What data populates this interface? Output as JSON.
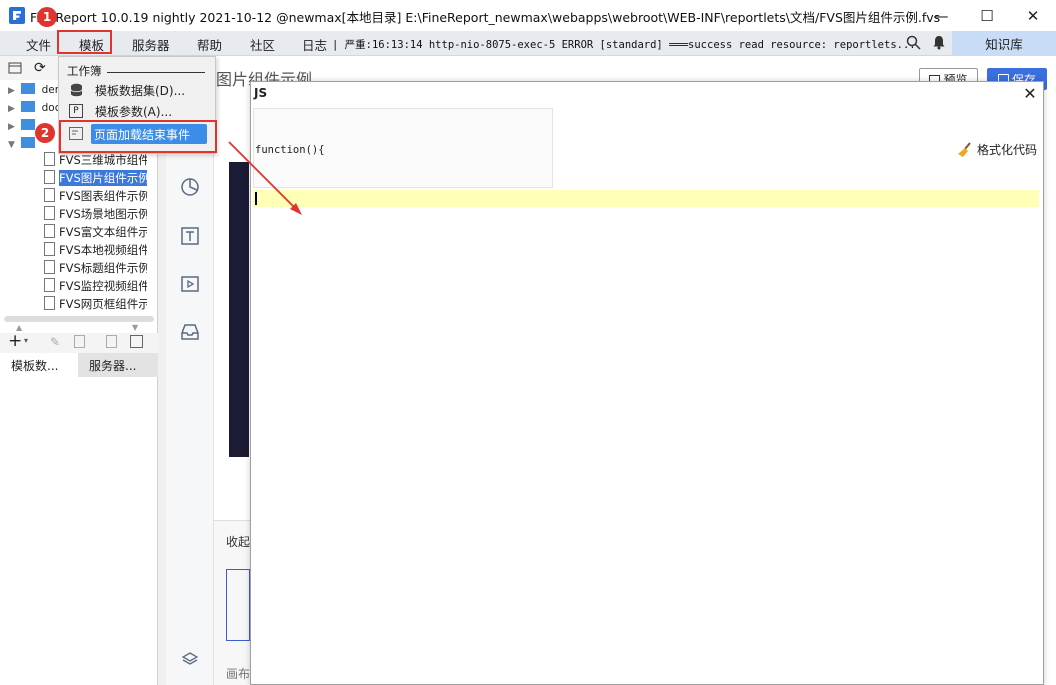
{
  "window": {
    "title": "FineReport 10.0.19 nightly 2021-10-12 @newmax[本地目录]    E:\\FineReport_newmax\\webapps\\webroot\\WEB-INF\\reportlets\\文档/FVS图片组件示例.fvs",
    "minimize": "—",
    "maximize": "☐",
    "close": "✕"
  },
  "menubar": {
    "items": [
      "文件",
      "模板",
      "服务器",
      "帮助",
      "社区",
      "日志"
    ],
    "log_text": "| 严重:16:13:14 http-nio-8075-exec-5 ERROR [standard] ═══success read resource: reportlets...",
    "knowledge_base": "知识库"
  },
  "tree": {
    "folders": [
      "dem",
      "doc",
      "",
      ""
    ],
    "files": [
      {
        "label": "FVS三维城市组件",
        "selected": false
      },
      {
        "label": "FVS图片组件示例",
        "selected": true
      },
      {
        "label": "FVS图表组件示例",
        "selected": false
      },
      {
        "label": "FVS场景地图示例",
        "selected": false
      },
      {
        "label": "FVS富文本组件示",
        "selected": false
      },
      {
        "label": "FVS本地视频组件",
        "selected": false
      },
      {
        "label": "FVS标题组件示例",
        "selected": false
      },
      {
        "label": "FVS监控视频组件",
        "selected": false
      },
      {
        "label": "FVS网页框组件示",
        "selected": false
      }
    ]
  },
  "bottom_tabs": [
    "模板数...",
    "服务器..."
  ],
  "editor": {
    "doc_title": "图片组件示例",
    "preview": "预览",
    "save": "保存",
    "collapse_label": "收起",
    "canvas_label": "画布"
  },
  "dropdown": {
    "group_label": "工作簿",
    "items": [
      "模板数据集(D)...",
      "模板参数(A)...",
      "页面加载结束事件"
    ]
  },
  "dialog": {
    "title": "JS",
    "close": "✕",
    "function_header": "function(){",
    "format_button": "格式化代码"
  },
  "annotations": {
    "step1": "1",
    "step2": "2"
  },
  "colors": {
    "accent": "#3d8ce8",
    "annotation_red": "#e0352f",
    "code_line_highlight": "#ffffb8",
    "save_blue": "#3b6fe0"
  }
}
